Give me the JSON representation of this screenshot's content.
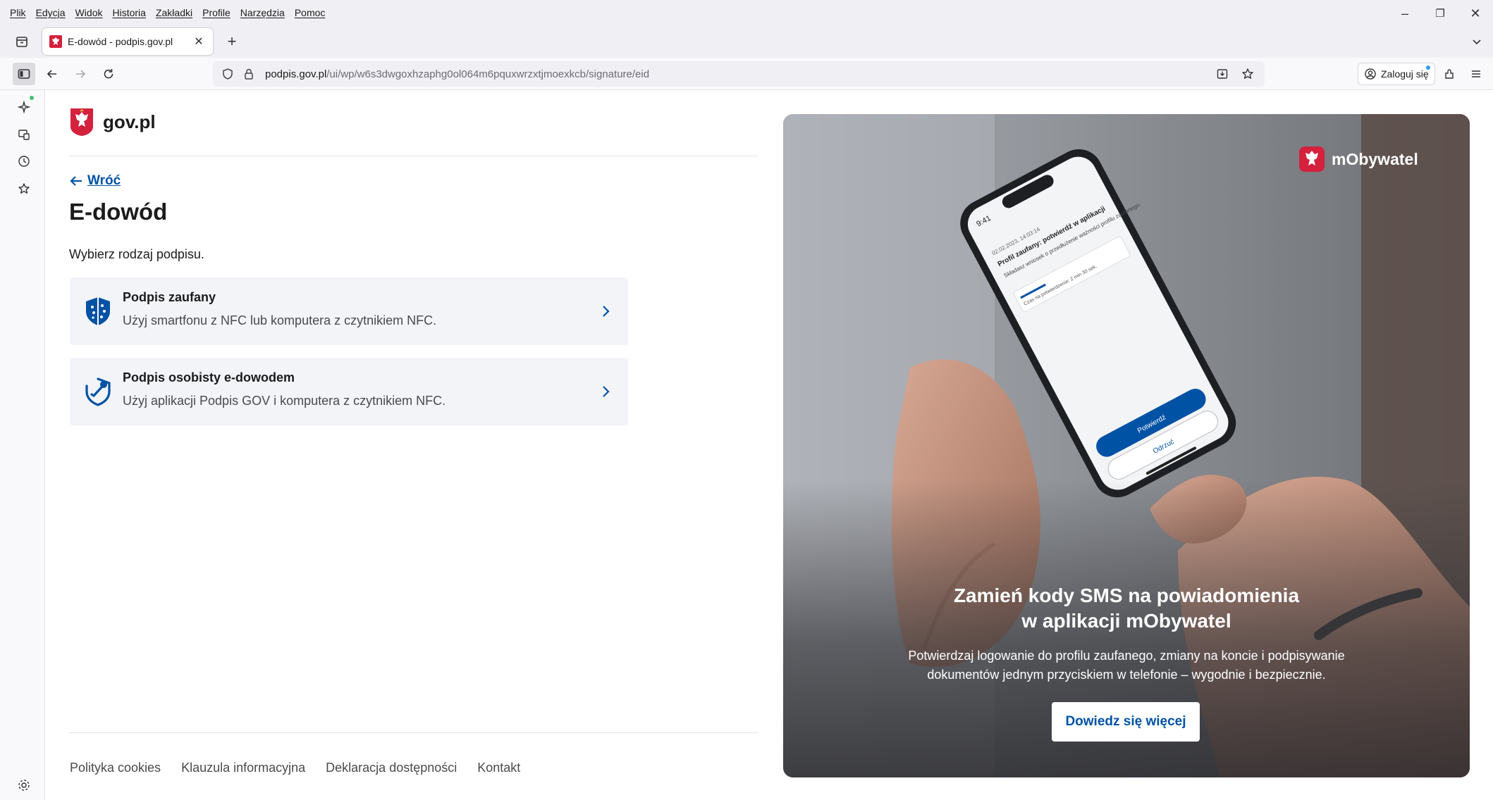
{
  "menu": {
    "items": [
      "Plik",
      "Edycja",
      "Widok",
      "Historia",
      "Zakładki",
      "Profile",
      "Narzędzia",
      "Pomoc"
    ]
  },
  "window_controls": {
    "minimize": "–",
    "restore": "❐",
    "close": "✕"
  },
  "tab": {
    "title": "E-dowód - podpis.gov.pl",
    "close": "✕",
    "new_tab": "+"
  },
  "urlbar": {
    "host": "podpis.gov.pl",
    "path": "/ui/wp/w6s3dwgoxhzaphg0ol064m6pquxwrzxtjmoexkcb/signature/eid"
  },
  "toolbar": {
    "login_label": "Zaloguj się"
  },
  "icons": {
    "sidebar": [
      "ai-sparkle-icon",
      "synced-tabs-icon",
      "history-icon",
      "bookmarks-icon",
      "settings-icon"
    ],
    "nav": [
      "back-arrow-icon",
      "forward-arrow-icon",
      "reload-icon"
    ]
  },
  "site": {
    "logo_text": "gov.pl",
    "back_label": "Wróć",
    "title": "E-dowód",
    "intro": "Wybierz rodzaj podpisu.",
    "options": [
      {
        "title": "Podpis zaufany",
        "description": "Użyj smartfonu z NFC lub komputera z czytnikiem NFC."
      },
      {
        "title": "Podpis osobisty e-dowodem",
        "description": "Użyj aplikacji Podpis GOV i komputera z czytnikiem NFC."
      }
    ],
    "footer_links": [
      "Polityka cookies",
      "Klauzula informacyjna",
      "Deklaracja dostępności",
      "Kontakt"
    ]
  },
  "promo": {
    "brand": "mObywatel",
    "heading_line1": "Zamień kody SMS na powiadomienia",
    "heading_line2": "w aplikacji mObywatel",
    "description_line1": "Potwierdzaj logowanie do profilu zaufanego, zmiany na koncie i podpisywanie",
    "description_line2": "dokumentów jednym przyciskiem w telefonie – wygodnie i bezpiecznie.",
    "button_label": "Dowiedz się więcej",
    "phone": {
      "time": "9:41",
      "date": "02.02.2023, 14:03:14",
      "title": "Profil zaufany: potwierdź w aplikacji",
      "body": "Składasz wniosek o przedłużenie ważności profilu zaufanego.",
      "timer": "Czas na potwierdzenie: 2 min 30 sek.",
      "confirm": "Potwierdź",
      "reject": "Odrzuć"
    }
  },
  "colors": {
    "gov_blue": "#0052a5",
    "card_bg": "#f2f4f8",
    "emblem_red": "#d4213d"
  }
}
